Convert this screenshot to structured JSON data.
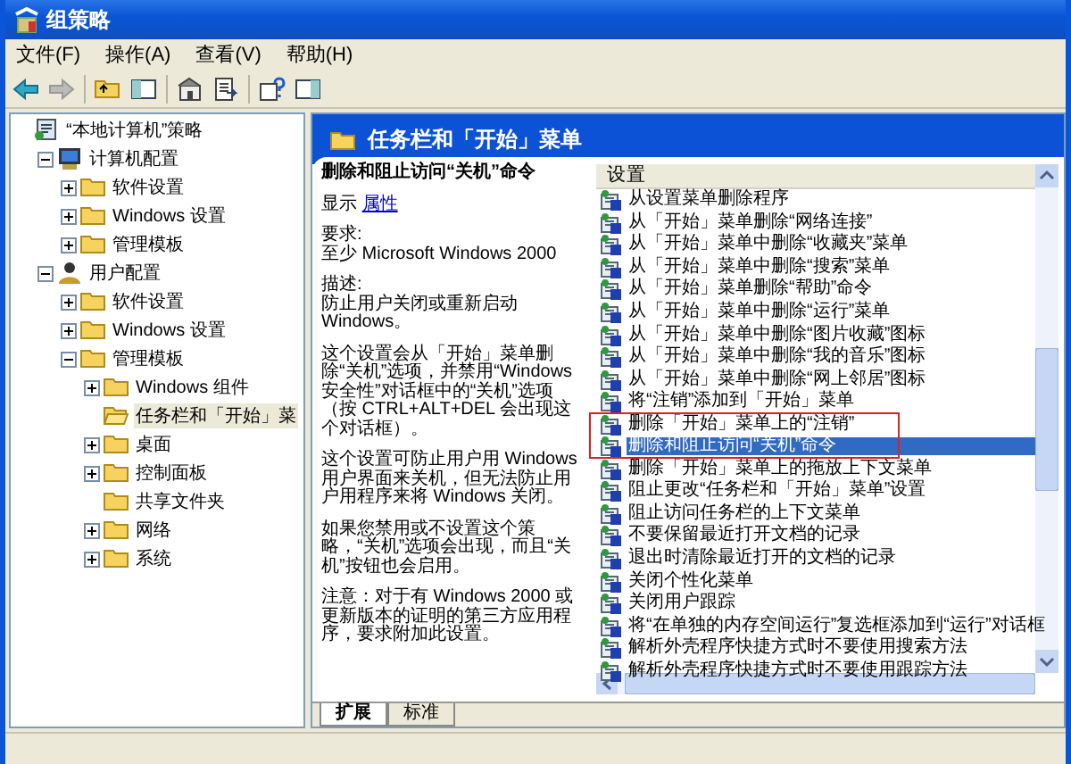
{
  "window": {
    "title": "组策略"
  },
  "menu": [
    "文件(F)",
    "操作(A)",
    "查看(V)",
    "帮助(H)"
  ],
  "tree": [
    {
      "label": "“本地计算机”策略",
      "kind": "policy",
      "expandable": false,
      "selected": false,
      "children": [
        {
          "label": "计算机配置",
          "kind": "computer",
          "expandable": true,
          "expanded": true,
          "selected": false,
          "children": [
            {
              "label": "软件设置",
              "kind": "folder",
              "expandable": true,
              "expanded": false,
              "selected": false
            },
            {
              "label": "Windows 设置",
              "kind": "folder",
              "expandable": true,
              "expanded": false,
              "selected": false
            },
            {
              "label": "管理模板",
              "kind": "folder",
              "expandable": true,
              "expanded": false,
              "selected": false
            }
          ]
        },
        {
          "label": "用户配置",
          "kind": "user",
          "expandable": true,
          "expanded": true,
          "selected": false,
          "children": [
            {
              "label": "软件设置",
              "kind": "folder",
              "expandable": true,
              "expanded": false,
              "selected": false
            },
            {
              "label": "Windows 设置",
              "kind": "folder",
              "expandable": true,
              "expanded": false,
              "selected": false
            },
            {
              "label": "管理模板",
              "kind": "folder",
              "expandable": true,
              "expanded": true,
              "selected": false,
              "children": [
                {
                  "label": "Windows 组件",
                  "kind": "folder",
                  "expandable": true,
                  "expanded": false,
                  "selected": false
                },
                {
                  "label": "任务栏和「开始」菜",
                  "kind": "open-folder",
                  "expandable": false,
                  "selected": true
                },
                {
                  "label": "桌面",
                  "kind": "folder",
                  "expandable": true,
                  "expanded": false,
                  "selected": false
                },
                {
                  "label": "控制面板",
                  "kind": "folder",
                  "expandable": true,
                  "expanded": false,
                  "selected": false
                },
                {
                  "label": "共享文件夹",
                  "kind": "folder",
                  "expandable": false,
                  "selected": false
                },
                {
                  "label": "网络",
                  "kind": "folder",
                  "expandable": true,
                  "expanded": false,
                  "selected": false
                },
                {
                  "label": "系统",
                  "kind": "folder",
                  "expandable": true,
                  "expanded": false,
                  "selected": false
                }
              ]
            }
          ]
        }
      ]
    }
  ],
  "pane_header": "任务栏和「开始」菜单",
  "description": {
    "title": "删除和阻止访问“关机”命令",
    "display_label": "显示",
    "display_link": "属性",
    "requirements_label": "要求:",
    "requirements": "至少 Microsoft Windows 2000",
    "description_label": "描述:",
    "paragraphs": [
      "防止用户关闭或重新启动 Windows。",
      "这个设置会从「开始」菜单删除“关机”选项，并禁用“Windows 安全性”对话框中的“关机”选项（按 CTRL+ALT+DEL 会出现这个对话框）。",
      "这个设置可防止用户用 Windows 用户界面来关机，但无法防止用户用程序来将 Windows 关闭。",
      "如果您禁用或不设置这个策略，“关机”选项会出现，而且“关机”按钮也会启用。",
      "注意：对于有 Windows 2000 或更新版本的证明的第三方应用程序，要求附加此设置。"
    ]
  },
  "settings": {
    "column": "设置",
    "rows": [
      {
        "label": "从设置菜单删除程序",
        "selected": false,
        "annotated": false
      },
      {
        "label": "从「开始」菜单删除“网络连接”",
        "selected": false,
        "annotated": false
      },
      {
        "label": "从「开始」菜单中删除“收藏夹”菜单",
        "selected": false,
        "annotated": false
      },
      {
        "label": "从「开始」菜单中删除“搜索”菜单",
        "selected": false,
        "annotated": false
      },
      {
        "label": "从「开始」菜单删除“帮助”命令",
        "selected": false,
        "annotated": false
      },
      {
        "label": "从「开始」菜单中删除“运行”菜单",
        "selected": false,
        "annotated": false
      },
      {
        "label": "从「开始」菜单中删除“图片收藏”图标",
        "selected": false,
        "annotated": false
      },
      {
        "label": "从「开始」菜单中删除“我的音乐”图标",
        "selected": false,
        "annotated": false
      },
      {
        "label": "从「开始」菜单中删除“网上邻居”图标",
        "selected": false,
        "annotated": false
      },
      {
        "label": "将“注销”添加到「开始」菜单",
        "selected": false,
        "annotated": false
      },
      {
        "label": "删除「开始」菜单上的“注销”",
        "selected": false,
        "annotated": true
      },
      {
        "label": "删除和阻止访问“关机”命令",
        "selected": true,
        "annotated": true
      },
      {
        "label": "删除「开始」菜单上的拖放上下文菜单",
        "selected": false,
        "annotated": false
      },
      {
        "label": "阻止更改“任务栏和「开始」菜单”设置",
        "selected": false,
        "annotated": false
      },
      {
        "label": "阻止访问任务栏的上下文菜单",
        "selected": false,
        "annotated": false
      },
      {
        "label": "不要保留最近打开文档的记录",
        "selected": false,
        "annotated": false
      },
      {
        "label": "退出时清除最近打开的文档的记录",
        "selected": false,
        "annotated": false
      },
      {
        "label": "关闭个性化菜单",
        "selected": false,
        "annotated": false
      },
      {
        "label": "关闭用户跟踪",
        "selected": false,
        "annotated": false
      },
      {
        "label": "将“在单独的内存空间运行”复选框添加到“运行”对话框",
        "selected": false,
        "annotated": false
      },
      {
        "label": "解析外壳程序快捷方式时不要使用搜索方法",
        "selected": false,
        "annotated": false
      },
      {
        "label": "解析外壳程序快捷方式时不要使用跟踪方法",
        "selected": false,
        "annotated": false
      }
    ]
  },
  "tabs": [
    {
      "label": "扩展",
      "selected": true
    },
    {
      "label": "标准",
      "selected": false
    }
  ]
}
